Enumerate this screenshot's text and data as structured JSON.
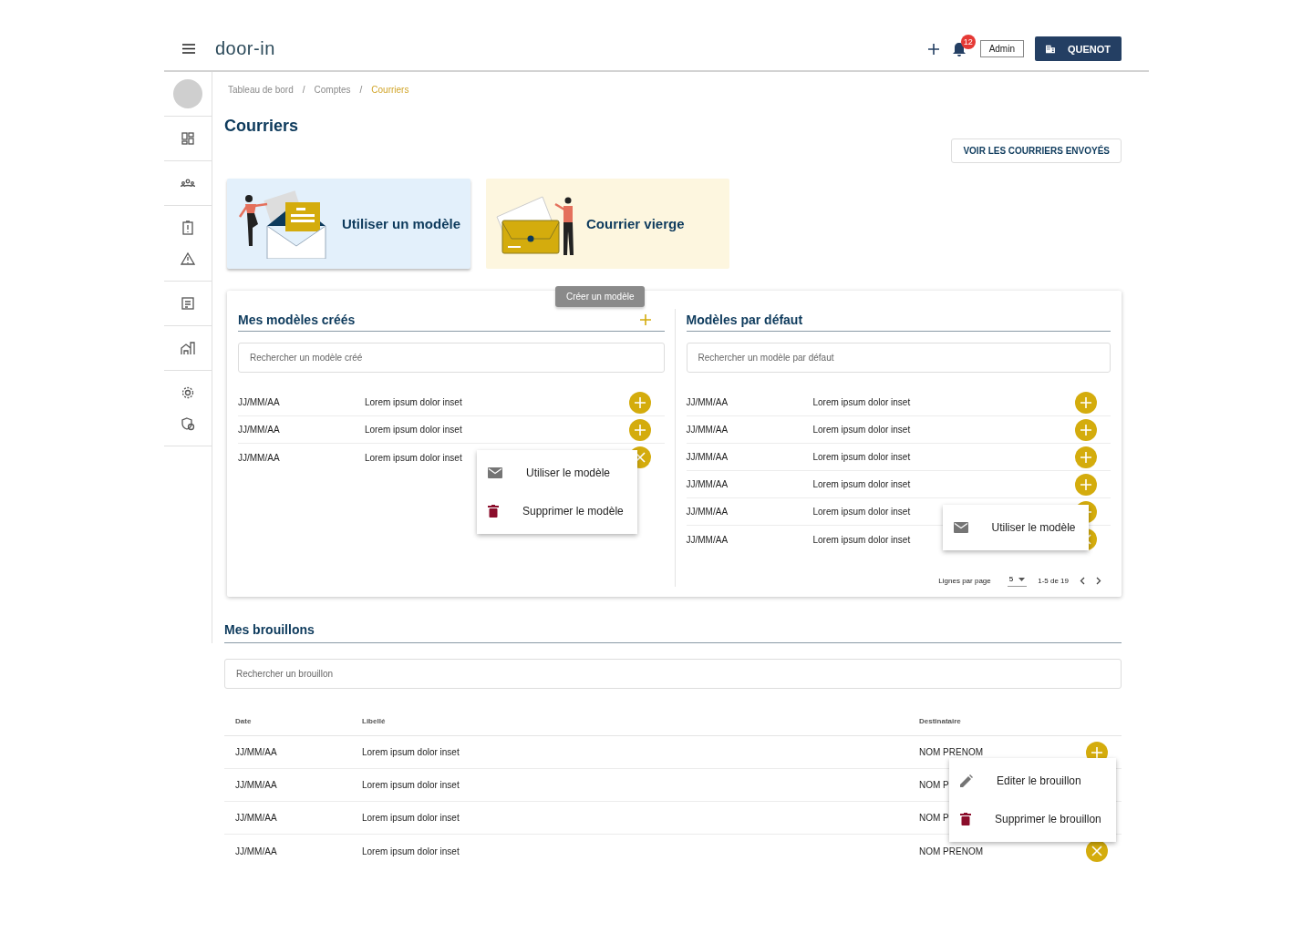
{
  "header": {
    "logo": "door-in",
    "notifications": "12",
    "role": "Admin",
    "account": "QUENOT"
  },
  "breadcrumb": [
    {
      "label": "Tableau de bord",
      "selected": false
    },
    {
      "separator": "/",
      "label": "Comptes",
      "selected": false
    },
    {
      "separator": "/",
      "label": "Courriers",
      "selected": true
    }
  ],
  "page_title": "Courriers",
  "sent_button": "VOIR LES COURRIERS ENVOYÉS",
  "action_cards": [
    {
      "label": "Utiliser un modèle",
      "kind": "template"
    },
    {
      "label": "Courrier vierge",
      "kind": "blank"
    }
  ],
  "created_templates": {
    "title": "Mes modèles créés",
    "tooltip": "Créer un modèle",
    "search_placeholder": "Rechercher un modèle créé",
    "rows": [
      {
        "date": "JJ/MM/AA",
        "label": "Lorem ipsum dolor inset",
        "open": false
      },
      {
        "date": "JJ/MM/AA",
        "label": "Lorem ipsum dolor inset",
        "open": false
      },
      {
        "date": "JJ/MM/AA",
        "label": "Lorem ipsum dolor inset",
        "open": true
      }
    ],
    "menu": [
      {
        "label": "Utiliser le modèle",
        "kind": "use"
      },
      {
        "label": "Supprimer le modèle",
        "kind": "delete"
      }
    ]
  },
  "default_templates": {
    "title": "Modèles par défaut",
    "search_placeholder": "Rechercher un modèle par défaut",
    "rows": [
      {
        "date": "JJ/MM/AA",
        "label": "Lorem ipsum dolor inset",
        "open": false
      },
      {
        "date": "JJ/MM/AA",
        "label": "Lorem ipsum dolor inset",
        "open": false
      },
      {
        "date": "JJ/MM/AA",
        "label": "Lorem ipsum dolor inset",
        "open": false
      },
      {
        "date": "JJ/MM/AA",
        "label": "Lorem ipsum dolor inset",
        "open": false
      },
      {
        "date": "JJ/MM/AA",
        "label": "Lorem ipsum dolor inset",
        "open": false
      },
      {
        "date": "JJ/MM/AA",
        "label": "Lorem ipsum dolor inset",
        "open": true
      }
    ],
    "menu": [
      {
        "label": "Utiliser le modèle",
        "kind": "use"
      }
    ],
    "pagination": {
      "label": "Lignes par page",
      "per_page": "5",
      "range": "1-5 de 19"
    }
  },
  "drafts": {
    "title": "Mes brouillons",
    "search_placeholder": "Rechercher un brouillon",
    "columns": [
      "Date",
      "Libellé",
      "Destinataire"
    ],
    "rows": [
      {
        "date": "JJ/MM/AA",
        "label": "Lorem ipsum dolor inset",
        "recipient": "NOM PRENOM",
        "open": false
      },
      {
        "date": "JJ/MM/AA",
        "label": "Lorem ipsum dolor inset",
        "recipient": "NOM P"
      },
      {
        "date": "JJ/MM/AA",
        "label": "Lorem ipsum dolor inset",
        "recipient": "NOM P"
      },
      {
        "date": "JJ/MM/AA",
        "label": "Lorem ipsum dolor inset",
        "recipient": "NOM PRENOM",
        "open": true
      }
    ],
    "menu": [
      {
        "label": "Editer le brouillon",
        "kind": "edit"
      },
      {
        "label": "Supprimer le brouillon",
        "kind": "delete"
      }
    ]
  }
}
